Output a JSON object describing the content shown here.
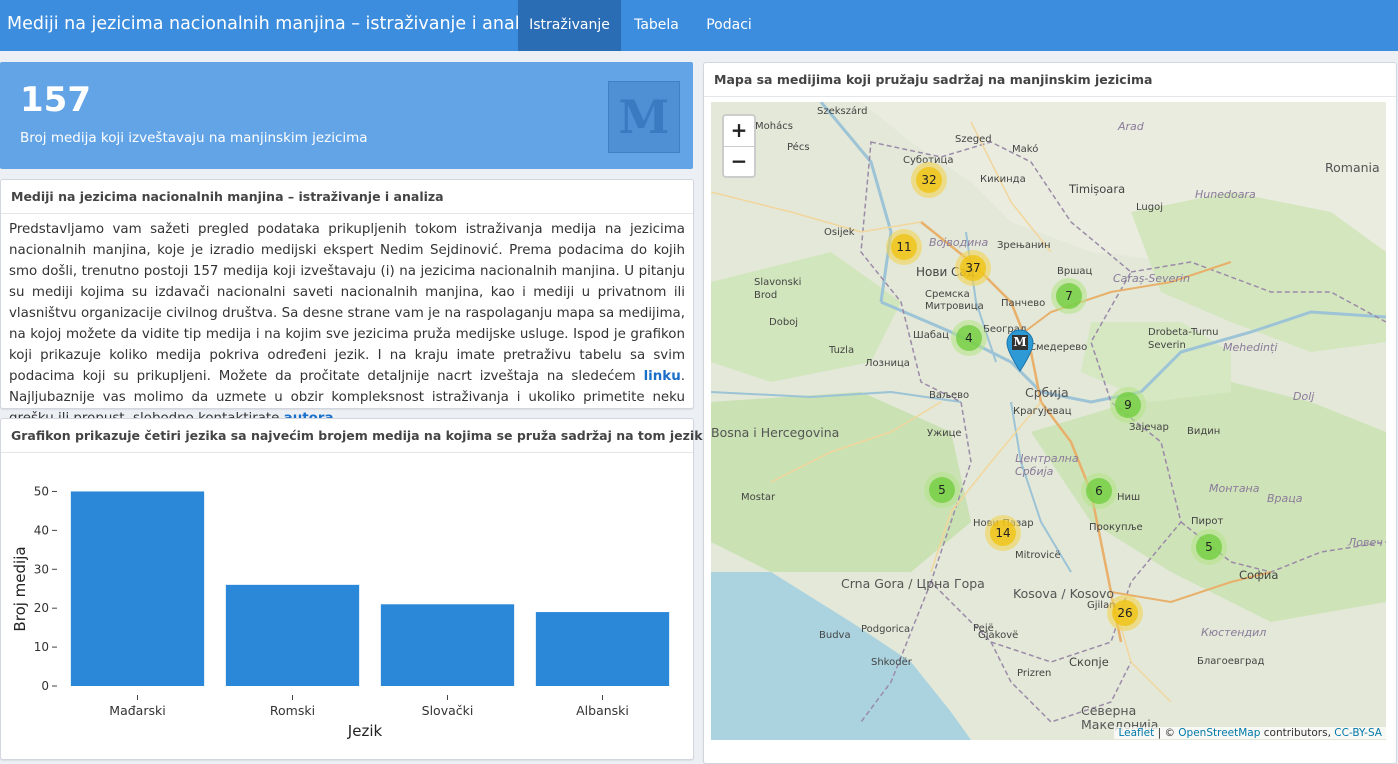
{
  "header": {
    "title": "Mediji na jezicima nacionalnih manjina – istraživanje i analiza",
    "tabs": [
      {
        "label": "Istraživanje",
        "active": true
      },
      {
        "label": "Tabela",
        "active": false
      },
      {
        "label": "Podaci",
        "active": false
      }
    ],
    "color": "#3c8dde"
  },
  "value_box": {
    "number": "157",
    "caption": "Broj medija koji izveštavaju na manjinskim jezicima",
    "logo_letter": "M"
  },
  "intro": {
    "title": "Mediji na jezicima nacionalnih manjina – istraživanje i analiza",
    "text_part1": "Predstavljamo vam sažeti pregled podataka prikupljenih tokom istraživanja medija na jezicima nacionalnih manjina, koje je izradio medijski ekspert Nedim Sejdinović. Prema podacima do kojih smo došli, trenutno postoji 157 medija koji izveštavaju (i) na jezicima nacionalnih manjina. U pitanju su mediji kojima su izdavači nacionalni saveti nacionalnih manjina, kao i mediji u privatnom ili vlasništvu organizacije civilnog društva. Sa desne strane vam je na raspolaganju mapa sa medijima, na kojoj možete da vidite tip medija i na kojim sve jezicima pruža medijske usluge. Ispod je grafikon koji prikazuje koliko medija pokriva određeni jezik. I na kraju imate pretraživu tabelu sa svim podacima koji su prikupljeni. Možete da pročitate detaljnije nacrt izveštaja na sledećem ",
    "link1": "linku",
    "text_part2": ". Najljubaznije vas molimo da uzmete u obzir kompleksnost istraživanja i ukoliko primetite neku grešku ili propust, slobodno kontaktirate ",
    "link2": "autora",
    "text_part3": "."
  },
  "chart_box": {
    "title": "Grafikon prikazuje četiri jezika sa najvećim brojem medija na kojima se pruža sadržaj na tom jeziku"
  },
  "chart_data": {
    "type": "bar",
    "categories": [
      "Mađarski",
      "Romski",
      "Slovački",
      "Albanski"
    ],
    "values": [
      50,
      26,
      21,
      19
    ],
    "xlabel": "Jezik",
    "ylabel": "Broj medija",
    "ylim": [
      0,
      55
    ],
    "yticks": [
      0,
      10,
      20,
      30,
      40,
      50
    ],
    "color": "#2b88d8"
  },
  "map_box": {
    "title": "Mapa sa medijima koji pružaju sadržaj na manjinskim jezicima",
    "zoom_in": "+",
    "zoom_out": "−",
    "attribution": {
      "leaflet": "Leaflet",
      "sep": " | © ",
      "osm": "OpenStreetMap",
      "contrib": " contributors, ",
      "license": "CC-BY-SA"
    },
    "clusters": [
      {
        "count": "32",
        "level": "yellow"
      },
      {
        "count": "11",
        "level": "yellow"
      },
      {
        "count": "37",
        "level": "yellow"
      },
      {
        "count": "7",
        "level": "green"
      },
      {
        "count": "4",
        "level": "green"
      },
      {
        "count": "9",
        "level": "green"
      },
      {
        "count": "5",
        "level": "green"
      },
      {
        "count": "6",
        "level": "green"
      },
      {
        "count": "14",
        "level": "yellow"
      },
      {
        "count": "5",
        "level": "green"
      },
      {
        "count": "26",
        "level": "yellow"
      }
    ],
    "marker_letter": "M",
    "places": [
      "Szekszárd",
      "Arad",
      "Mohács",
      "Szeged",
      "Makó",
      "Pécs",
      "Суботица",
      "Кикинда",
      "Timișoara",
      "Romania",
      "Hunedoara",
      "Osijek",
      "Lugoj",
      "Војводина",
      "Зрењанин",
      "Нови Сад",
      "Вршац",
      "Caraș-Severin",
      "Slavonski Brod",
      "Сремска Митровица",
      "Панчево",
      "Doboj",
      "Шабац",
      "Београд",
      "Drobeta-Turnu Severin",
      "Mehedinți",
      "Tuzla",
      "Смедерево",
      "Лозница",
      "Србија",
      "Dolj",
      "Ваљево",
      "Крагујевац",
      "Зајечар",
      "Видин",
      "Bosna i Hercegovina",
      "Ужице",
      "Централна Србија",
      "Монтана",
      "Mostar",
      "Ниш",
      "Враца",
      "Нови Пазар",
      "Прокупље",
      "Пирот",
      "Ловеч",
      "Mitrovicë",
      "Софиа",
      "Crna Gora / Црна Гора",
      "Pejë",
      "Kosova / Kosovo",
      "Gjilan",
      "Budva",
      "Podgorica",
      "Gjakovë",
      "Кюстендил",
      "Shkodër",
      "Prizren",
      "Скопје",
      "Благоевград",
      "Северна Македонија"
    ]
  }
}
